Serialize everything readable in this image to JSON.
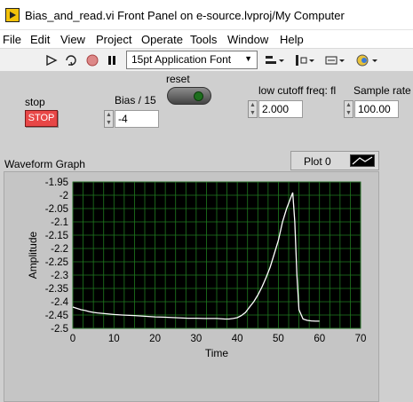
{
  "window": {
    "title": "Bias_and_read.vi Front Panel on e-source.lvproj/My Computer"
  },
  "menu": [
    "File",
    "Edit",
    "View",
    "Project",
    "Operate",
    "Tools",
    "Window",
    "Help"
  ],
  "toolbar": {
    "font_select": "15pt Application Font",
    "icons": [
      "run-arrow-icon",
      "run-continuously-icon",
      "abort-icon",
      "pause-icon",
      "align-objects-icon",
      "distribute-objects-icon",
      "resize-objects-icon",
      "reorder-icon"
    ]
  },
  "controls": {
    "stop_label": "stop",
    "stop_button": "STOP",
    "bias_label": "Bias / 15",
    "bias_value": "-4",
    "reset_label": "reset",
    "cutoff_label": "low cutoff freq: fl",
    "cutoff_value": "2.000",
    "sample_rate_label": "Sample rate",
    "sample_rate_value": "100.00"
  },
  "graph": {
    "title": "Waveform Graph",
    "legend_name": "Plot 0"
  },
  "chart_data": {
    "type": "line",
    "title": "Waveform Graph",
    "xlabel": "Time",
    "ylabel": "Amplitude",
    "xlim": [
      0,
      70
    ],
    "ylim": [
      -2.5,
      -1.95
    ],
    "x_ticks": [
      0,
      10,
      20,
      30,
      40,
      50,
      60,
      70
    ],
    "y_ticks": [
      -1.95,
      -2,
      -2.05,
      -2.1,
      -2.15,
      -2.2,
      -2.25,
      -2.3,
      -2.35,
      -2.4,
      -2.45,
      -2.5
    ],
    "grid": true,
    "series": [
      {
        "name": "Plot 0",
        "color": "#ffffff",
        "x": [
          0,
          1,
          2,
          3,
          4,
          5,
          6,
          8,
          10,
          12,
          15,
          18,
          20,
          22,
          25,
          28,
          30,
          32,
          35,
          37,
          38,
          39,
          40,
          41,
          42,
          43,
          44,
          45,
          46,
          47,
          48,
          49,
          50,
          51,
          52,
          53,
          53.5,
          54,
          54.5,
          55,
          56,
          57,
          58,
          59,
          60
        ],
        "y": [
          -2.42,
          -2.425,
          -2.43,
          -2.433,
          -2.437,
          -2.44,
          -2.442,
          -2.445,
          -2.448,
          -2.45,
          -2.452,
          -2.455,
          -2.457,
          -2.458,
          -2.46,
          -2.462,
          -2.462,
          -2.463,
          -2.463,
          -2.465,
          -2.465,
          -2.463,
          -2.46,
          -2.452,
          -2.44,
          -2.42,
          -2.4,
          -2.375,
          -2.345,
          -2.31,
          -2.27,
          -2.22,
          -2.17,
          -2.1,
          -2.05,
          -2.01,
          -1.99,
          -2.1,
          -2.3,
          -2.43,
          -2.465,
          -2.47,
          -2.472,
          -2.473,
          -2.473
        ]
      }
    ]
  },
  "colors": {
    "panel_bg": "#cfcfcf",
    "plot_bg": "#000000",
    "grid": "#1f7a1f",
    "trace": "#ffffff",
    "stop_button": "#e84747"
  }
}
